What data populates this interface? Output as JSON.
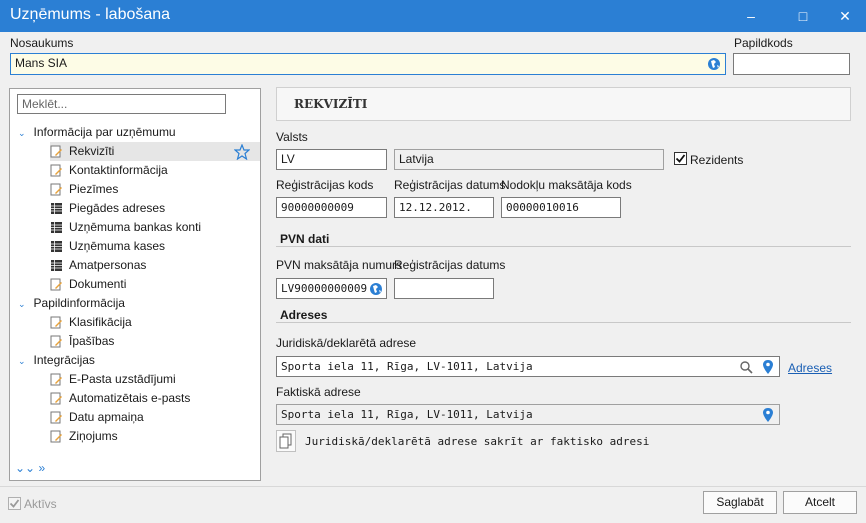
{
  "window": {
    "title": "Uzņēmums - labošana",
    "minimize": "–",
    "maximize": "□",
    "close": "✕"
  },
  "header": {
    "name_label": "Nosaukums",
    "name_value": "Mans SIA",
    "extra_code_label": "Papildkods",
    "extra_code_value": ""
  },
  "sidebar": {
    "search_placeholder": "Meklēt...",
    "groups": [
      {
        "label": "Informācija par uzņēmumu",
        "items": [
          "Rekvizīti",
          "Kontaktinformācija",
          "Piezīmes",
          "Piegādes adreses",
          "Uzņēmuma bankas konti",
          "Uzņēmuma kases",
          "Amatpersonas",
          "Dokumenti"
        ]
      },
      {
        "label": "Papildinformācija",
        "items": [
          "Klasifikācija",
          "Īpašības"
        ]
      },
      {
        "label": "Integrācijas",
        "items": [
          "E-Pasta uzstādījumi",
          "Automatizētais e-pasts",
          "Datu apmaiņa",
          "Ziņojums"
        ]
      }
    ],
    "selected": "Rekvizīti"
  },
  "content": {
    "section_title": "REKVIZĪTI",
    "country_label": "Valsts",
    "country_code": "LV",
    "country_name": "Latvija",
    "resident_label": "Rezidents",
    "resident_checked": true,
    "reg_code_label": "Reģistrācijas kods",
    "reg_code_value": "90000000009",
    "reg_date_label": "Reģistrācijas datums",
    "reg_date_value": "12.12.2012.",
    "tax_no_label": "Nodokļu maksātāja kods",
    "tax_no_value": "00000010016",
    "vat_title": "PVN dati",
    "vat_no_label": "PVN maksātāja numurs",
    "vat_no_value": "LV90000000009",
    "vat_reg_date_label": "Reģistrācijas datums",
    "vat_reg_date_value": "",
    "addresses_title": "Adreses",
    "legal_address_label": "Juridiskā/deklarētā adrese",
    "legal_address_value": "Sporta iela 11, Rīga, LV-1011, Latvija",
    "addresses_link": "Adreses",
    "actual_address_label": "Faktiskā adrese",
    "actual_address_value": "Sporta iela 11, Rīga, LV-1011, Latvija",
    "same_address_text": "Juridiskā/deklarētā adrese sakrīt ar faktisko adresi"
  },
  "footer": {
    "active_label": "Aktīvs",
    "save_label": "Saglabāt",
    "cancel_label": "Atcelt"
  },
  "colors": {
    "accent": "#2b7fd4",
    "link": "#1a5fb4",
    "pin": "#2b7fd4"
  }
}
